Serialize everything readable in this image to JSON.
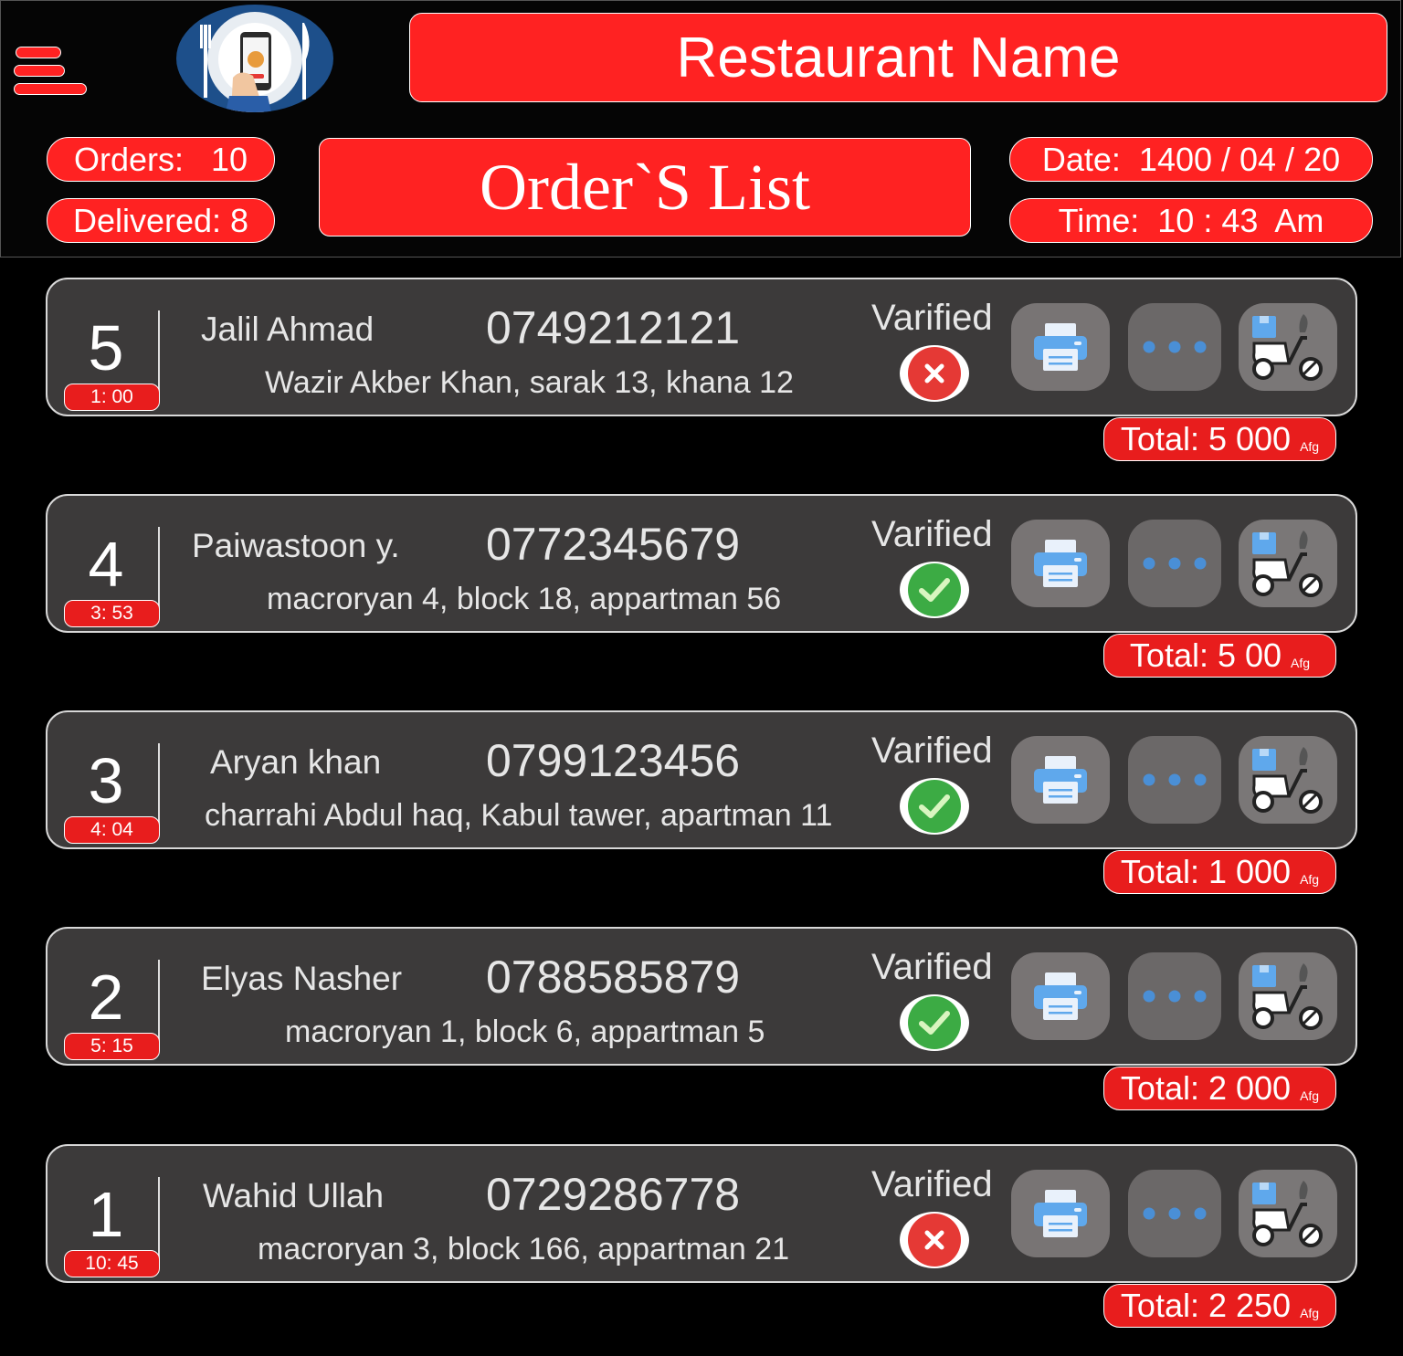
{
  "header": {
    "restaurant_name": "Restaurant Name",
    "list_title": "Order`S List",
    "orders_label": "Orders:   10",
    "delivered_label": "Delivered: 8",
    "date_label": "Date:  1400 / 04 / 20",
    "time_label": "Time:  10 : 43  Am",
    "menu_icon": "hamburger-menu-icon",
    "logo_icon": "food-order-app-logo"
  },
  "orders": [
    {
      "number": "5",
      "time": "1: 00",
      "name": "Jalil Ahmad",
      "phone": "0749212121",
      "address": "Wazir Akber Khan, sarak 13, khana 12",
      "verified_label": "Varified",
      "verified": false,
      "total": "Total: 5 000",
      "currency": "Afg"
    },
    {
      "number": "4",
      "time": "3: 53",
      "name": "Paiwastoon y.",
      "phone": "0772345679",
      "address": "macroryan 4, block 18, appartman 56",
      "verified_label": "Varified",
      "verified": true,
      "total": "Total: 5 00",
      "currency": "Afg"
    },
    {
      "number": "3",
      "time": "4: 04",
      "name": "Aryan khan",
      "phone": "0799123456",
      "address": "charrahi Abdul haq, Kabul tawer, apartman 11",
      "verified_label": "Varified",
      "verified": true,
      "total": "Total: 1 000",
      "currency": "Afg"
    },
    {
      "number": "2",
      "time": "5: 15",
      "name": "Elyas Nasher",
      "phone": "0788585879",
      "address": "macroryan 1, block 6, appartman 5",
      "verified_label": "Varified",
      "verified": true,
      "total": "Total: 2 000",
      "currency": "Afg"
    },
    {
      "number": "1",
      "time": "10: 45",
      "name": "Wahid Ullah",
      "phone": "0729286778",
      "address": "macroryan 3, block 166, appartman 21",
      "verified_label": "Varified",
      "verified": false,
      "total": "Total: 2 250",
      "currency": "Afg"
    }
  ],
  "action_icons": [
    "printer-icon",
    "more-options-icon",
    "delivery-scooter-icon"
  ],
  "colors": {
    "accent": "#f22222",
    "card": "#3c3a3a",
    "verified_ok": "#3cab44",
    "verified_no": "#e53935"
  }
}
